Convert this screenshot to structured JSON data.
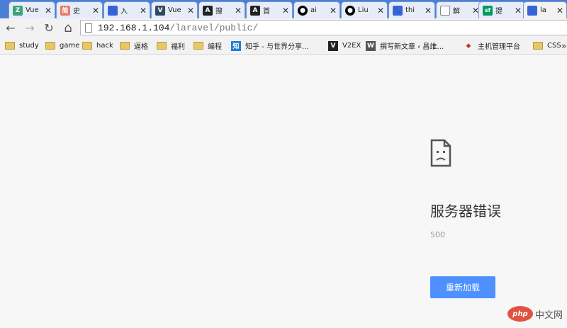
{
  "tabs": [
    {
      "title": "Vue",
      "icon": "zhihu-like-green-icon",
      "color": "#3aa37a",
      "glyph": "Z"
    },
    {
      "title": "史",
      "icon": "jianshu-icon",
      "color": "#e9796a",
      "glyph": "简"
    },
    {
      "title": "入",
      "icon": "baidu-paw-icon",
      "color": "#3b63d8",
      "glyph": "🐾"
    },
    {
      "title": "Vue",
      "icon": "vue-dark-icon",
      "color": "#35495e",
      "glyph": "V"
    },
    {
      "title": "搜",
      "icon": "ac-icon",
      "color": "#222222",
      "glyph": "A"
    },
    {
      "title": "首",
      "icon": "ac-icon",
      "color": "#222222",
      "glyph": "A"
    },
    {
      "title": "ai",
      "icon": "github-icon",
      "color": "#000000",
      "glyph": "●"
    },
    {
      "title": "Liu",
      "icon": "github-icon",
      "color": "#000000",
      "glyph": "●"
    },
    {
      "title": "thi",
      "icon": "baidu-paw-icon",
      "color": "#3b63d8",
      "glyph": "🐾"
    },
    {
      "title": "解",
      "icon": "blank-page-icon",
      "color": "#ffffff",
      "glyph": ""
    },
    {
      "title": "提",
      "icon": "segmentfault-icon",
      "color": "#009a61",
      "glyph": "sf"
    },
    {
      "title": "la",
      "icon": "baidu-paw-icon",
      "color": "#3b63d8",
      "glyph": "🐾"
    }
  ],
  "tab_close_glyph": "✕",
  "toolbar": {
    "back_glyph": "←",
    "forward_glyph": "→",
    "reload_glyph": "↻",
    "home_glyph": "⌂"
  },
  "address": {
    "host": "192.168.1.104",
    "path": "/laravel/public/"
  },
  "bookmarks": [
    {
      "label": "study",
      "type": "folder"
    },
    {
      "label": "game",
      "type": "folder"
    },
    {
      "label": "hack",
      "type": "folder"
    },
    {
      "label": "逼格",
      "type": "folder"
    },
    {
      "label": "福利",
      "type": "folder"
    },
    {
      "label": "编程",
      "type": "folder"
    },
    {
      "label": "知乎 - 与世界分享…",
      "type": "site",
      "icon": "zhihu-icon",
      "color": "#1e80d6",
      "glyph": "知"
    },
    {
      "label": "V2EX",
      "type": "site",
      "icon": "v2ex-icon",
      "color": "#222222",
      "glyph": "V"
    },
    {
      "label": "撰写新文章 ‹ 昌维…",
      "type": "site",
      "icon": "wordpress-icon",
      "color": "#555555",
      "glyph": "W"
    },
    {
      "label": "主机管理平台",
      "type": "site",
      "icon": "host-panel-icon",
      "color": "#c0392b",
      "glyph": "◆"
    },
    {
      "label": "CSS",
      "type": "folder"
    }
  ],
  "bookmarks_more_glyph": "»",
  "error": {
    "title": "服务器错误",
    "code": "500",
    "reload_label": "重新加载"
  },
  "watermark": {
    "logo_text": "php",
    "text": "中文网"
  }
}
